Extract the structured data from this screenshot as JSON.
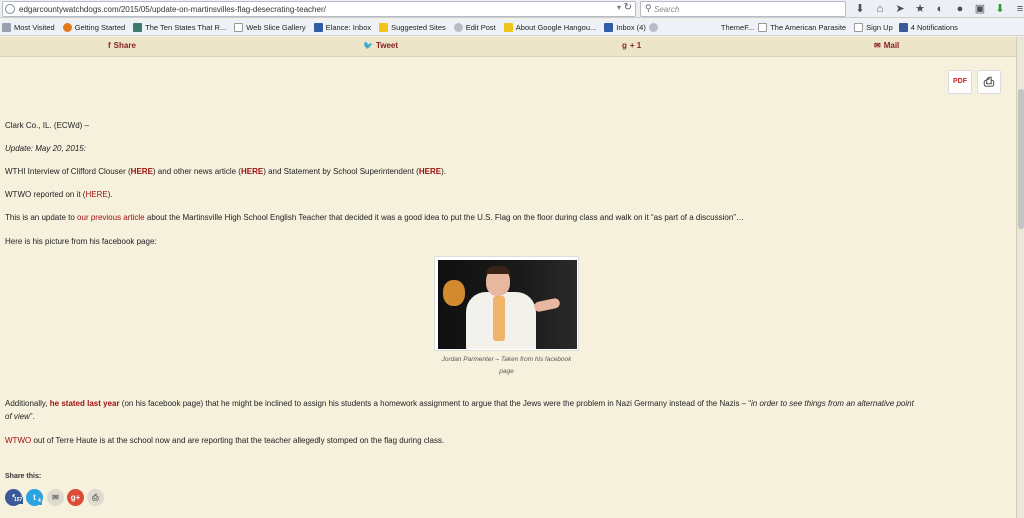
{
  "browser": {
    "url": "edgarcountywatchdogs.com/2015/05/update-on-martinsvilles-flag-desecrating-teacher/",
    "search_placeholder": "Search",
    "bookmarks": [
      {
        "label": "Most Visited",
        "icon": "grey"
      },
      {
        "label": "Getting Started",
        "icon": "orange"
      },
      {
        "label": "The Ten States That R...",
        "icon": "teal"
      },
      {
        "label": "Web Slice Gallery",
        "icon": "page"
      },
      {
        "label": "Elance: Inbox",
        "icon": "blue"
      },
      {
        "label": "Suggested Sites",
        "icon": "yellow"
      },
      {
        "label": "Edit Post",
        "icon": "gear"
      },
      {
        "label": "About Google Hangou...",
        "icon": "yellow"
      },
      {
        "label": "Inbox (4)",
        "icon": "blue"
      },
      {
        "label": "ThemeF...",
        "icon": "page"
      },
      {
        "label": "The American Parasite",
        "icon": "page"
      },
      {
        "label": "Sign Up",
        "icon": "page"
      },
      {
        "label": "4 Notifications",
        "icon": "fb"
      }
    ]
  },
  "share_bar": {
    "share": "Share",
    "tweet": "Tweet",
    "gplus": "+ 1",
    "mail": "Mail"
  },
  "article": {
    "dateline": "Clark Co., IL. (ECWd) –",
    "update": "Update: May 20, 2015:",
    "wthi_1": "WTHI Interview of Clifford Clouser (",
    "here": "HERE",
    "wthi_2": ") and other news article (",
    "wthi_3": ") and Statement by School Superintendent (",
    "wthi_4": ").",
    "wtwo_1": "WTWO reported on it (",
    "wtwo_2": ").",
    "update_1": "This is an update to ",
    "previous_article": "our previous article",
    "update_2": " about the Martinsville High School English Teacher that decided it was a good idea to put the U.S.  Flag on the floor during class and walk on it “as part of a discussion”…",
    "picture_line": "Here is his picture from his facebook page:",
    "caption": "Jordan Parmenter – Taken from his facebook page",
    "add_1": "Additionally, ",
    "stated_last_year": "he stated last year",
    "add_2": " (on his facebook page) that he might be inclined to assign his students a homework assignment to argue that the Jews were the problem in Nazi Germany instead of the Nazis – “",
    "add_quote_1": "in order to see things from an alternative point",
    "add_quote_2": "of view",
    "add_end": "”.",
    "wtwo_link": "WTWO",
    "last": " out of Terre Haute is at the school now and are reporting that the teacher allegedly stomped on the flag during class.",
    "share_this": "Share this:",
    "fb_count": "157",
    "tw_count": "4"
  }
}
